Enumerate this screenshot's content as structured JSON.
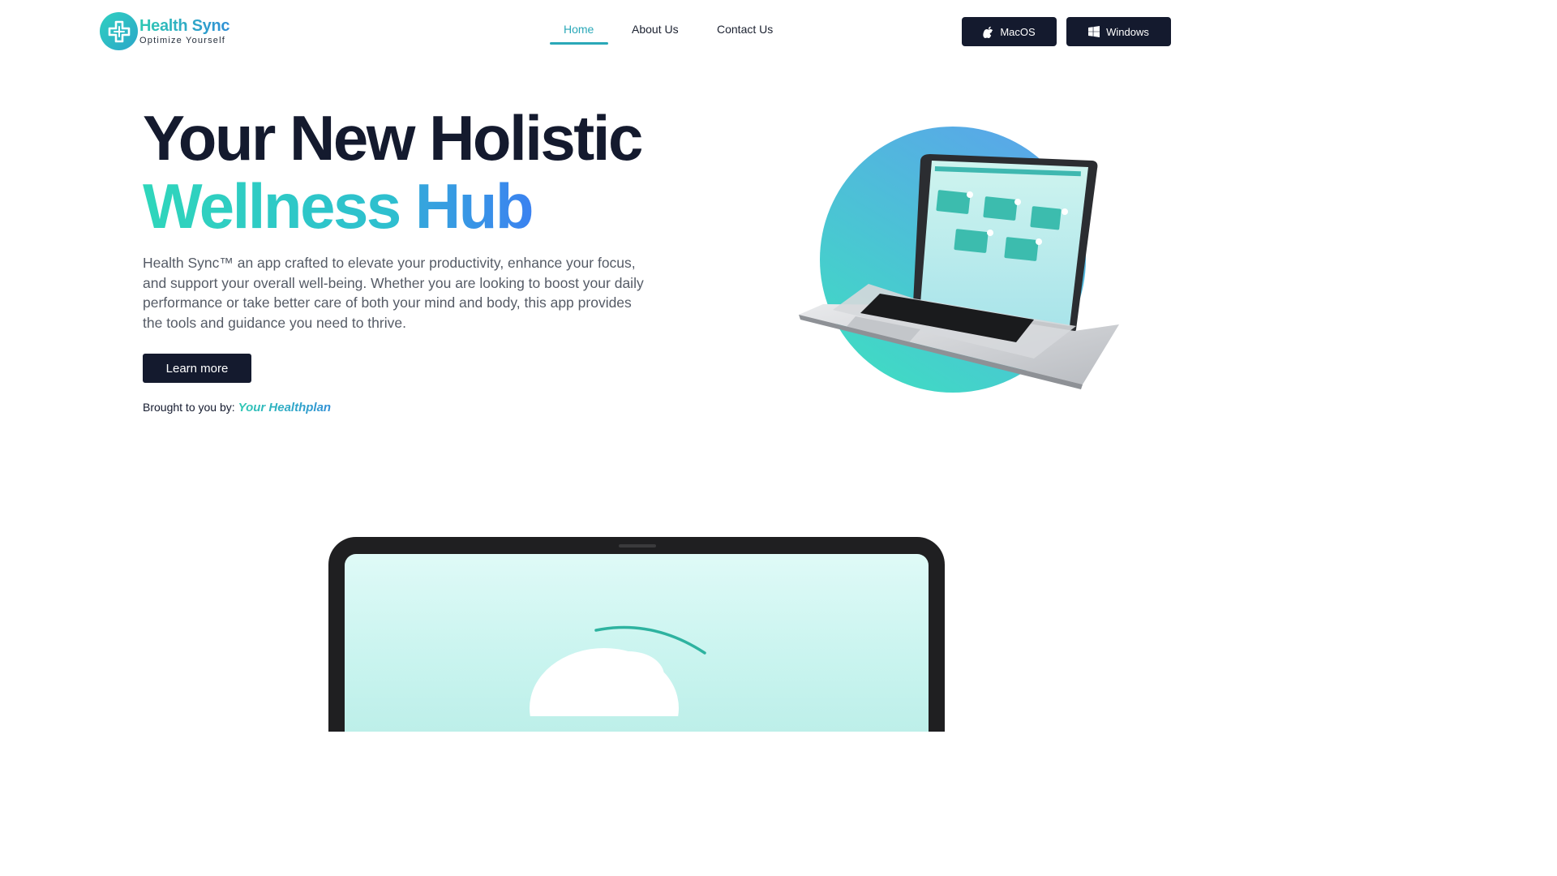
{
  "header": {
    "logo": {
      "title": "Health Sync",
      "tagline": "Optimize Yourself",
      "icon": "health-cross-icon"
    },
    "nav": [
      {
        "label": "Home",
        "active": true
      },
      {
        "label": "About Us",
        "active": false
      },
      {
        "label": "Contact Us",
        "active": false
      }
    ],
    "downloads": [
      {
        "label": "MacOS",
        "icon": "apple-icon"
      },
      {
        "label": "Windows",
        "icon": "windows-icon"
      }
    ]
  },
  "hero": {
    "title_line1": "Your New Holistic",
    "title_word_a": "Wellness",
    "title_word_b": "Hub",
    "description": "Health Sync™ an app crafted to elevate your productivity, enhance your focus, and support your overall well-being. Whether you are looking to boost your daily performance or take better care of both your mind and body, this app provides the tools and guidance you need to thrive.",
    "cta_label": "Learn more",
    "brought_by_label": "Brought to you by:",
    "brought_by_name": "Your Healthplan"
  },
  "colors": {
    "navy": "#141a2e",
    "accent_teal": "#2aa8b8",
    "gradient_start": "#2fd6bb",
    "gradient_end": "#3b82f0"
  }
}
